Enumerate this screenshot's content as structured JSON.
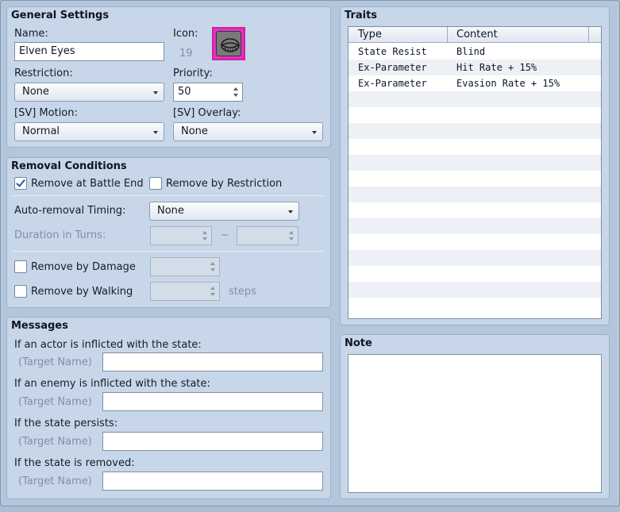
{
  "general": {
    "title": "General Settings",
    "name_label": "Name:",
    "name_value": "Elven Eyes",
    "icon_label": "Icon:",
    "icon_index": "19",
    "restriction_label": "Restriction:",
    "restriction_value": "None",
    "priority_label": "Priority:",
    "priority_value": "50",
    "sv_motion_label": "[SV] Motion:",
    "sv_motion_value": "Normal",
    "sv_overlay_label": "[SV] Overlay:",
    "sv_overlay_value": "None"
  },
  "removal": {
    "title": "Removal Conditions",
    "battle_end_label": "Remove at Battle End",
    "battle_end_checked": true,
    "restriction_label": "Remove by Restriction",
    "restriction_checked": false,
    "auto_timing_label": "Auto-removal Timing:",
    "auto_timing_value": "None",
    "duration_label": "Duration in Turns:",
    "duration_sep": "~",
    "damage_label": "Remove by Damage",
    "damage_checked": false,
    "walking_label": "Remove by Walking",
    "walking_checked": false,
    "steps_label": "steps"
  },
  "messages": {
    "title": "Messages",
    "target_placeholder": "(Target Name)",
    "items": [
      {
        "label": "If an actor is inflicted with the state:",
        "value": ""
      },
      {
        "label": "If an enemy is inflicted with the state:",
        "value": ""
      },
      {
        "label": "If the state persists:",
        "value": ""
      },
      {
        "label": "If the state is removed:",
        "value": ""
      }
    ]
  },
  "traits": {
    "title": "Traits",
    "columns": [
      "Type",
      "Content"
    ],
    "rows": [
      {
        "type": "State Resist",
        "content": "Blind"
      },
      {
        "type": "Ex-Parameter",
        "content": "Hit Rate + 15%"
      },
      {
        "type": "Ex-Parameter",
        "content": "Evasion Rate + 15%"
      }
    ]
  },
  "note": {
    "title": "Note",
    "value": ""
  },
  "colors": {
    "icon_border": "#d21fa3",
    "panel_bg": "#c7d7e9",
    "check_mark": "#2a5db0"
  }
}
